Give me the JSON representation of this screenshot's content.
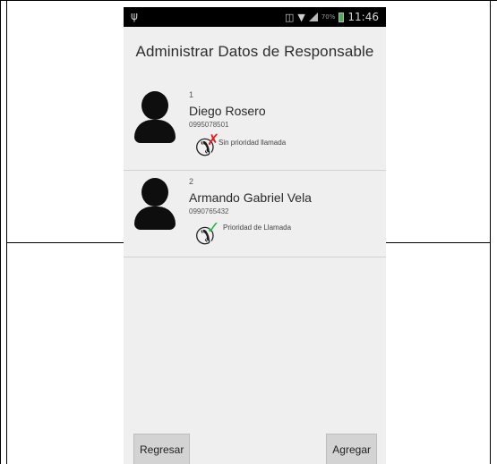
{
  "status_bar": {
    "usb_icon": "usb-icon",
    "battery_percent": "70%",
    "time": "11:46"
  },
  "screen": {
    "title": "Administrar Datos de Responsable"
  },
  "contacts": [
    {
      "index": "1",
      "name": "Diego Rosero",
      "phone": "0995078501",
      "priority_label": "Sin prioridad llamada",
      "priority": false
    },
    {
      "index": "2",
      "name": "Armando Gabriel Vela",
      "phone": "0990765432",
      "priority_label": "Prioridad de Llamada",
      "priority": true
    }
  ],
  "buttons": {
    "back": "Regresar",
    "add": "Agregar"
  },
  "colors": {
    "no_priority": "#e32020",
    "priority": "#27b34a"
  }
}
